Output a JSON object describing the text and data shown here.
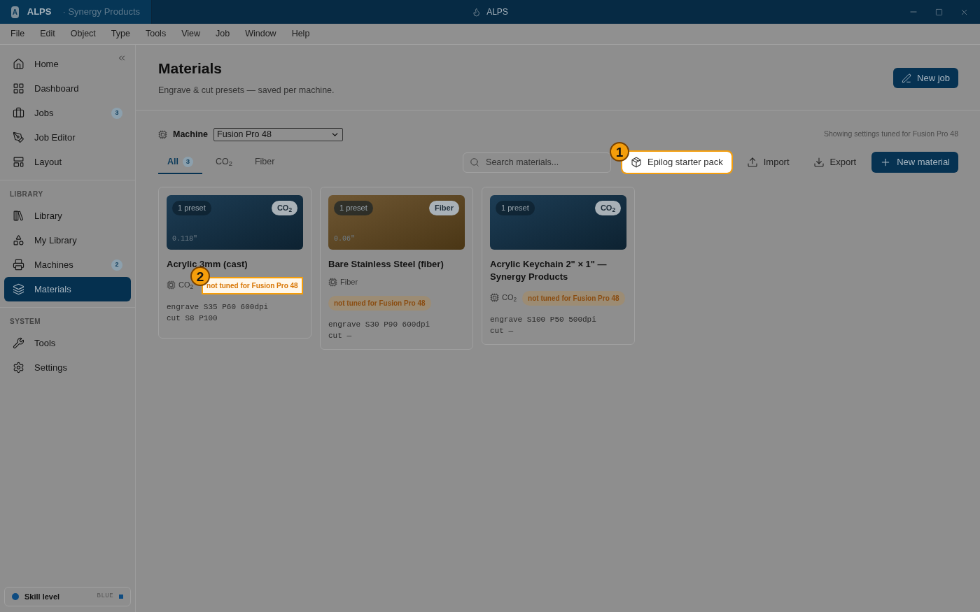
{
  "titlebar": {
    "logo": "A",
    "app": "ALPS",
    "workspace": "· Synergy Products",
    "title": "ALPS"
  },
  "menu": [
    "File",
    "Edit",
    "Object",
    "Type",
    "Tools",
    "View",
    "Job",
    "Window",
    "Help"
  ],
  "sidebar": {
    "sections": [
      {
        "items": [
          {
            "kind": "home",
            "label": "Home",
            "selected": false
          },
          {
            "kind": "dashboard",
            "label": "Dashboard",
            "selected": false
          },
          {
            "kind": "jobs",
            "label": "Jobs",
            "badge": "3",
            "selected": false
          },
          {
            "kind": "editor",
            "label": "Job Editor",
            "selected": false
          },
          {
            "kind": "layout",
            "label": "Layout",
            "selected": false
          }
        ]
      },
      {
        "heading": "LIBRARY",
        "items": [
          {
            "kind": "library",
            "label": "Library",
            "selected": false
          },
          {
            "kind": "shapes",
            "label": "My Library",
            "selected": false
          },
          {
            "kind": "printer",
            "label": "Machines",
            "badge": "2",
            "selected": false
          },
          {
            "kind": "layers",
            "label": "Materials",
            "selected": true
          }
        ]
      },
      {
        "heading": "SYSTEM",
        "items": [
          {
            "kind": "wrench",
            "label": "Tools",
            "selected": false
          },
          {
            "kind": "gear",
            "label": "Settings",
            "selected": false
          }
        ]
      }
    ],
    "skill": {
      "label": "Skill level",
      "value": "BLUE",
      "color": "#0f4c81"
    }
  },
  "header": {
    "title": "Materials",
    "subtitle": "Engrave & cut presets — saved per machine.",
    "button": "New job"
  },
  "machine": {
    "label": "Machine",
    "value": "Fusion Pro 48",
    "note": "Showing settings tuned for Fusion Pro 48"
  },
  "tabs": [
    {
      "label": "All",
      "count": "3",
      "selected": true
    },
    {
      "label": "CO$_{2}$",
      "selected": false
    },
    {
      "label": "Fiber",
      "selected": false
    }
  ],
  "search": {
    "placeholder": "Search materials..."
  },
  "actions": [
    {
      "kind": "outline",
      "label": "Epilog starter pack",
      "callout": "1"
    },
    {
      "kind": "ghost",
      "label": "Import"
    },
    {
      "kind": "ghost",
      "label": "Export"
    },
    {
      "kind": "primary",
      "label": "New material"
    }
  ],
  "cards": [
    {
      "kind": "co2",
      "presets": "1 preset",
      "type_badge": "CO$_{2}$",
      "thickness": "0.118\"",
      "title": "Acrylic 3mm (cast)",
      "type": "CO$_{2}$",
      "warning": "not tuned for Fusion Pro 48",
      "callout": "2",
      "settings": [
        "engrave S35 P60 600dpi",
        "cut S8 P100"
      ]
    },
    {
      "kind": "fiber",
      "presets": "1 preset",
      "type_badge": "Fiber",
      "thickness": "0.06\"",
      "title": "Bare Stainless Steel (fiber)",
      "type": "Fiber",
      "warning": "not tuned for Fusion Pro 48",
      "settings": [
        "engrave S30 P90 600dpi",
        "cut —"
      ]
    },
    {
      "kind": "co2",
      "presets": "1 preset",
      "type_badge": "CO$_{2}$",
      "title": "Acrylic Keychain 2\" × 1\" — Synergy Products",
      "type": "CO$_{2}$",
      "warning": "not tuned for Fusion Pro 48",
      "settings": [
        "engrave S100 P50 500dpi",
        "cut —"
      ]
    }
  ]
}
